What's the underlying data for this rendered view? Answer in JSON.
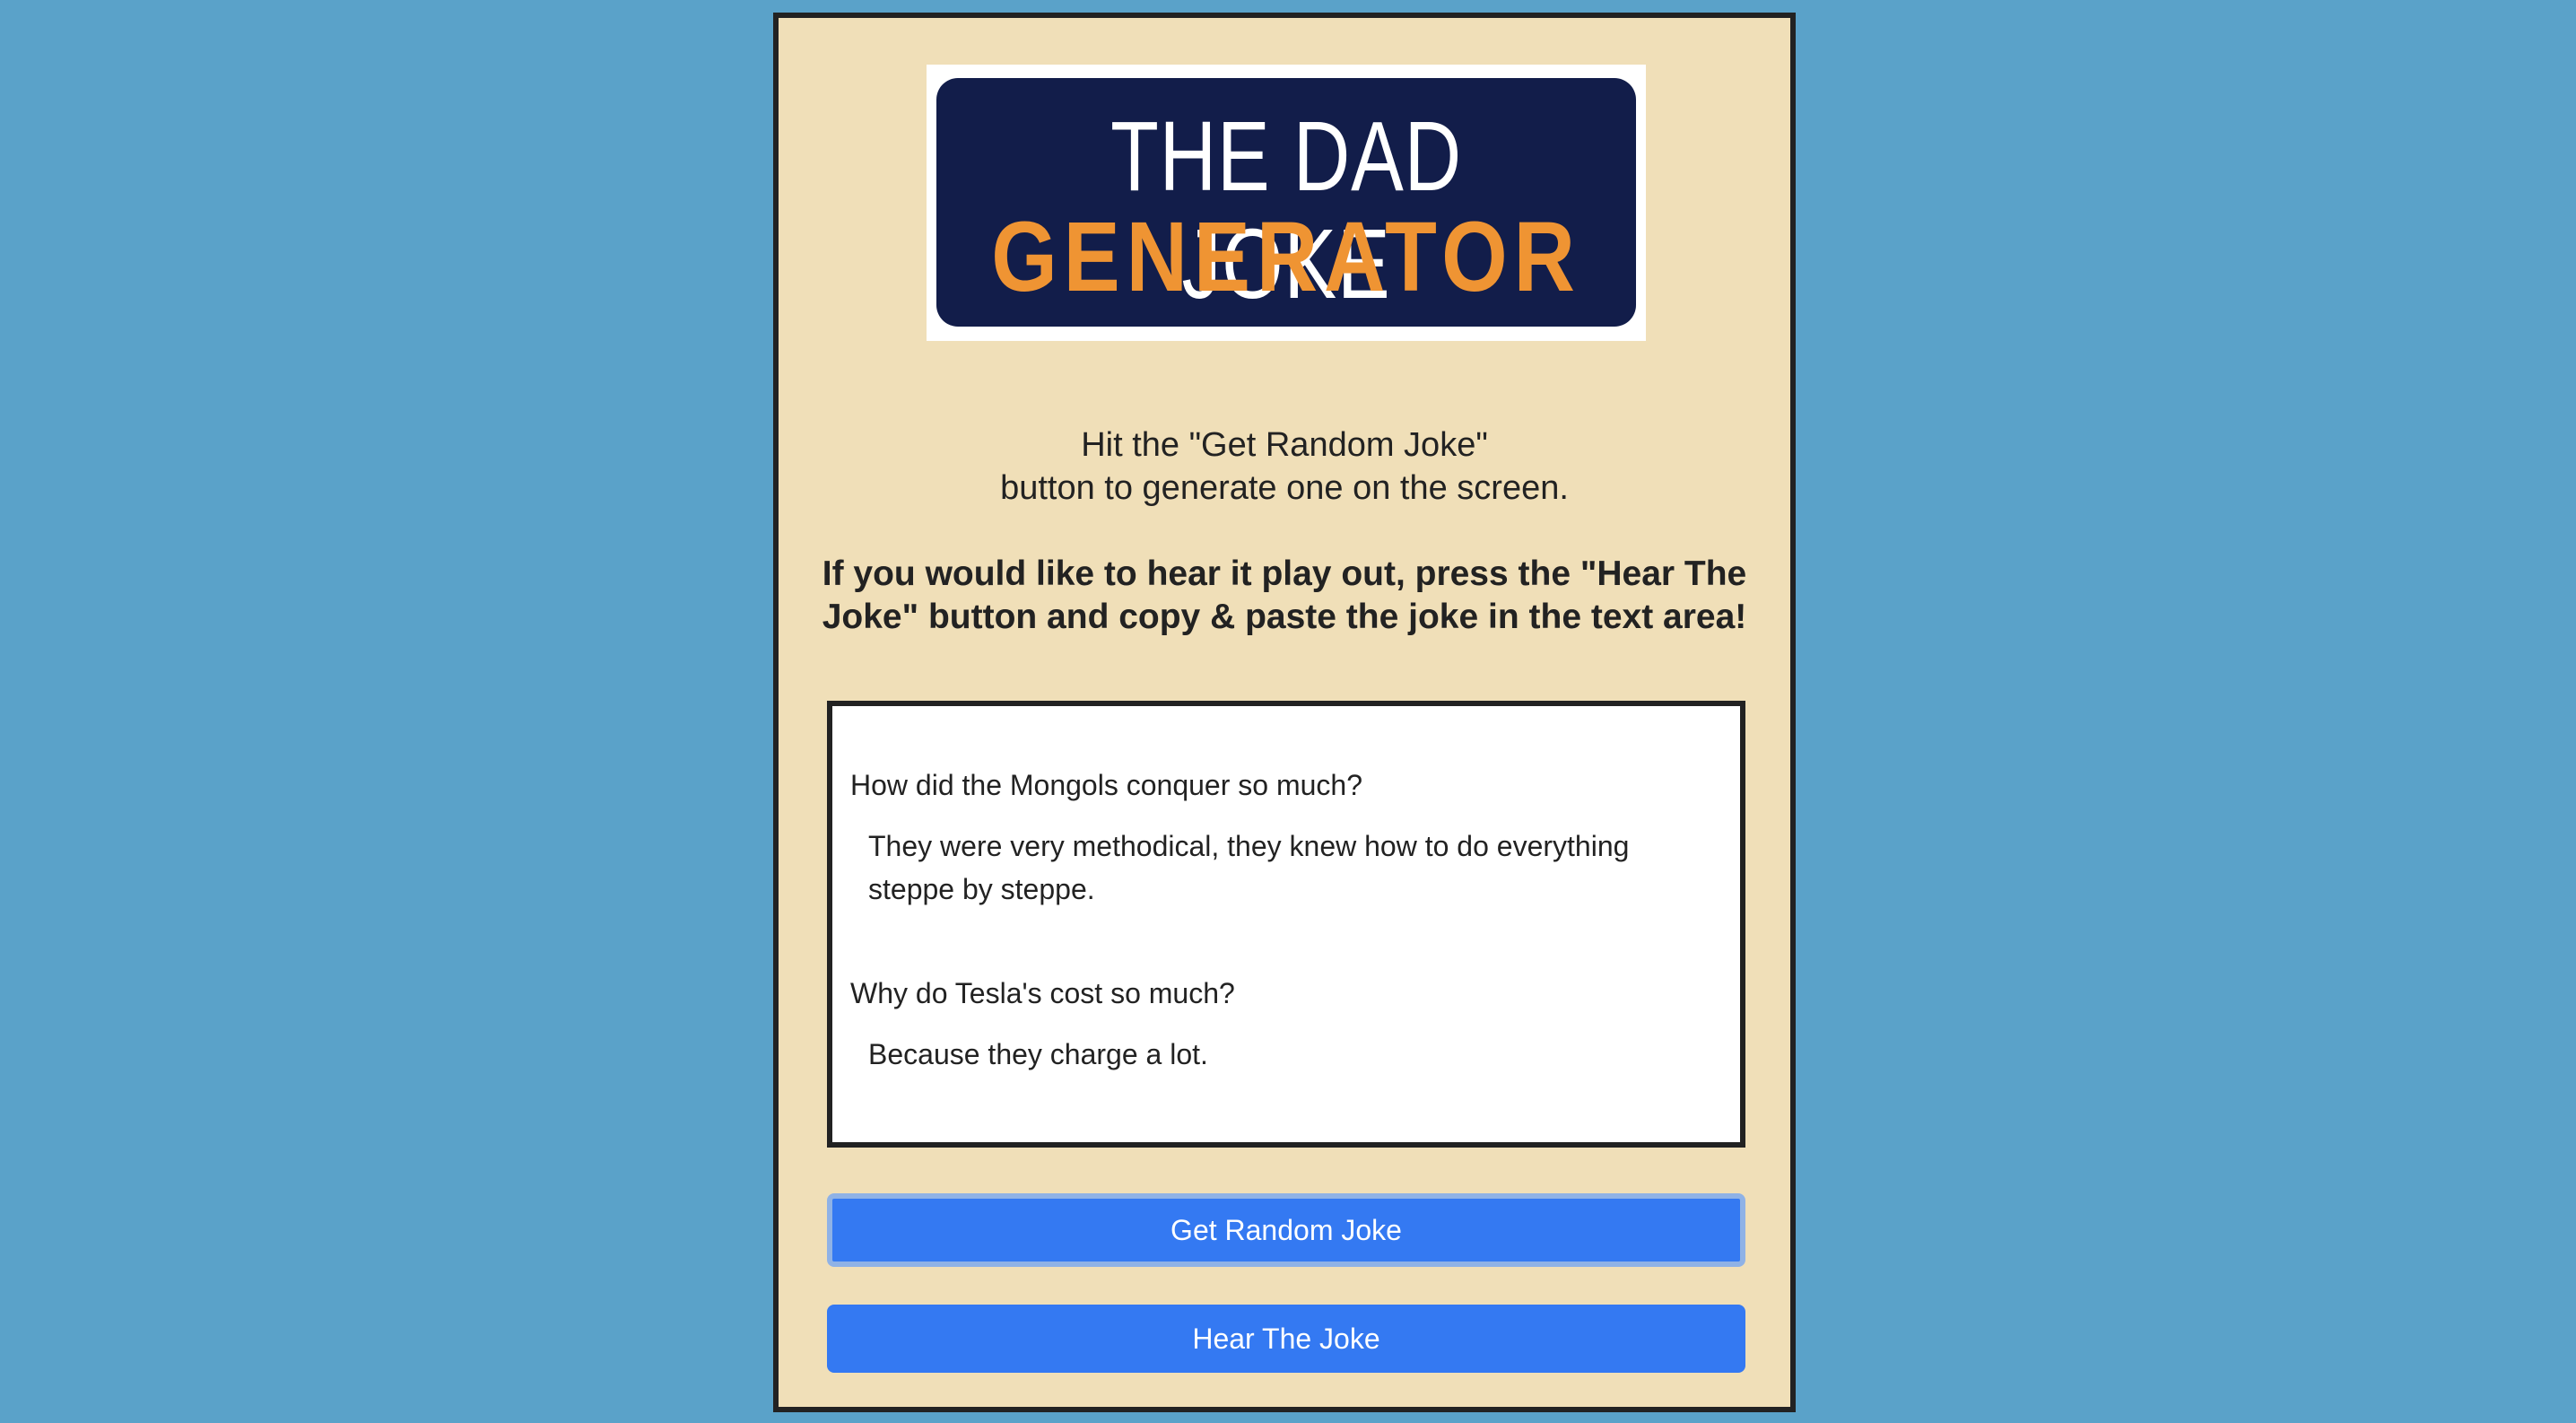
{
  "logo": {
    "line1": "THE DAD JOKE",
    "line2": "GENERATOR"
  },
  "instructions": {
    "line1": "Hit the \"Get Random Joke\"",
    "line2": "button to generate one on the screen.",
    "line3": "If you would like to hear it play out, press the \"Hear The",
    "line4": "Joke\" button and copy & paste the joke in the text area!"
  },
  "jokes": [
    {
      "setup": "How did the Mongols conquer so much?",
      "punch_line1": "They were very methodical, they knew how to do everything",
      "punch_line2": "steppe by steppe."
    },
    {
      "setup": "Why do Tesla's cost so much?",
      "punch_line1": "Because they charge a lot."
    }
  ],
  "buttons": {
    "random": "Get Random Joke",
    "hear": "Hear The Joke"
  },
  "colors": {
    "background": "#5aa2c9",
    "card": "#f0dfb8",
    "logo_navy": "#121d4a",
    "logo_orange": "#ef9433",
    "button_blue": "#3479f2"
  }
}
